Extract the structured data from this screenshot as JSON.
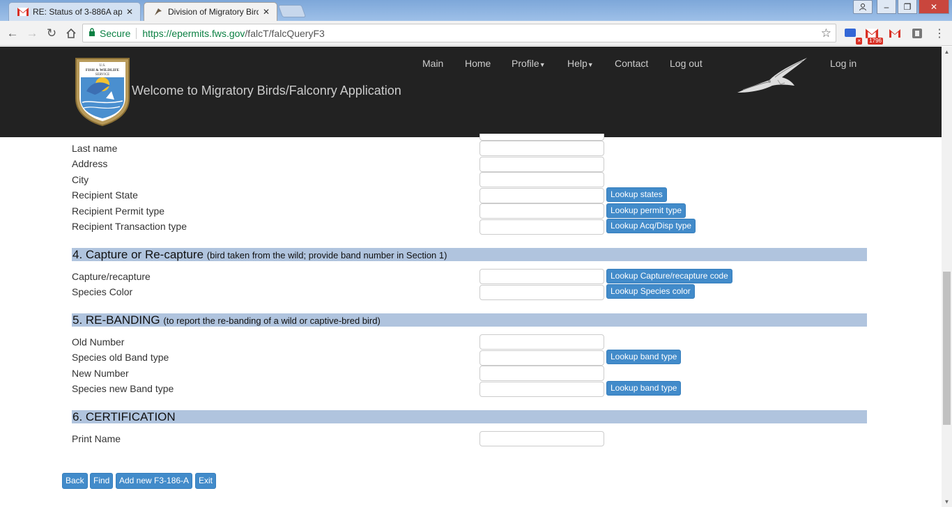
{
  "browser": {
    "tabs": [
      {
        "title": "RE: Status of 3-886A app",
        "favicon": "gmail-icon",
        "active": false
      },
      {
        "title": "Division of Migratory Bird",
        "favicon": "bird-icon",
        "active": true
      }
    ],
    "secure_label": "Secure",
    "url_scheme_host": "https://epermits.fws.gov",
    "url_path": "/falcT/falcQueryF3",
    "gmail_badge": "1796"
  },
  "header": {
    "seal_text_top": "U.S. FISH & WILDLIFE SERVICE",
    "welcome": "Welcome to Migratory Birds/Falconry Application",
    "nav": {
      "main": "Main",
      "home": "Home",
      "profile": "Profile",
      "help": "Help",
      "contact": "Contact",
      "logout": "Log out",
      "login": "Log in"
    }
  },
  "recipient_section": {
    "fields": [
      {
        "label": "Last name",
        "value": "",
        "lookup": ""
      },
      {
        "label": "Address",
        "value": "",
        "lookup": ""
      },
      {
        "label": "City",
        "value": "",
        "lookup": ""
      },
      {
        "label": "Recipient State",
        "value": "",
        "lookup": "Lookup states"
      },
      {
        "label": "Recipient Permit type",
        "value": "",
        "lookup": "Lookup permit type"
      },
      {
        "label": "Recipient Transaction type",
        "value": "",
        "lookup": "Lookup Acq/Disp type"
      }
    ]
  },
  "capture_section": {
    "title": "4. Capture or Re-capture",
    "subtitle": "(bird taken from the wild; provide band number in Section 1)",
    "fields": [
      {
        "label": "Capture/recapture",
        "value": "",
        "lookup": "Lookup Capture/recapture code"
      },
      {
        "label": "Species Color",
        "value": "",
        "lookup": "Lookup Species color"
      }
    ]
  },
  "rebanding_section": {
    "title": "5. RE-BANDING",
    "subtitle": "(to report the re-banding of a wild or captive-bred bird)",
    "fields": [
      {
        "label": "Old Number",
        "value": "",
        "lookup": ""
      },
      {
        "label": "Species old Band type",
        "value": "",
        "lookup": "Lookup band type"
      },
      {
        "label": "New Number",
        "value": "",
        "lookup": ""
      },
      {
        "label": "Species new Band type",
        "value": "",
        "lookup": "Lookup band type"
      }
    ]
  },
  "certification_section": {
    "title": "6. CERTIFICATION",
    "fields": [
      {
        "label": "Print Name",
        "value": ""
      }
    ]
  },
  "actions": {
    "back": "Back",
    "find": "Find",
    "add_new": "Add new F3-186-A",
    "exit": "Exit"
  },
  "colors": {
    "header_bg": "#222222",
    "section_bg": "#b0c4de",
    "button_primary": "#428bca"
  }
}
